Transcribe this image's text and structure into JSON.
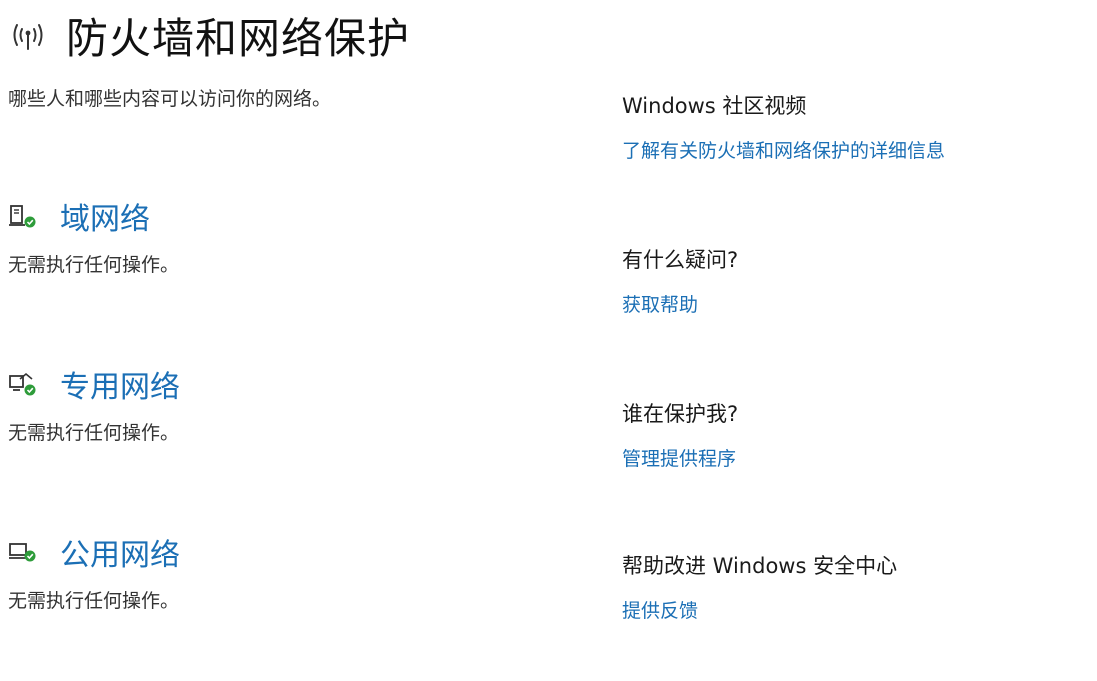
{
  "header": {
    "title": "防火墙和网络保护",
    "subtitle": "哪些人和哪些内容可以访问你的网络。",
    "icon": "wifi-signal-icon"
  },
  "networks": [
    {
      "title": "域网络",
      "status": "无需执行任何操作。",
      "icon": "domain-network-icon"
    },
    {
      "title": "专用网络",
      "status": "无需执行任何操作。",
      "icon": "private-network-icon"
    },
    {
      "title": "公用网络",
      "status": "无需执行任何操作。",
      "icon": "public-network-icon"
    }
  ],
  "sidebar": {
    "community": {
      "title": "Windows 社区视频",
      "link": "了解有关防火墙和网络保护的详细信息"
    },
    "question": {
      "title": "有什么疑问?",
      "link": "获取帮助"
    },
    "protect": {
      "title": "谁在保护我?",
      "link": "管理提供程序"
    },
    "improve": {
      "title": "帮助改进 Windows 安全中心",
      "link": "提供反馈"
    }
  },
  "colors": {
    "link": "#1b6fb5",
    "status_ok": "#2e9c3a",
    "text": "#1a1a1a"
  }
}
